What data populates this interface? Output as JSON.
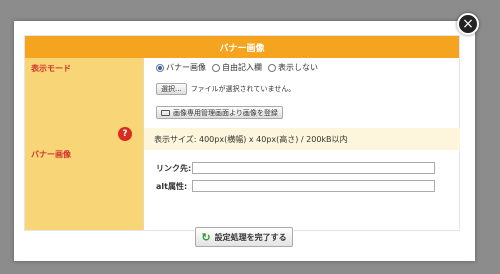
{
  "dialog": {
    "header_title": "バナー画像",
    "display_mode": {
      "label": "表示モード",
      "options": [
        "バナー画像",
        "自由記入欄",
        "表示しない"
      ],
      "selected": "バナー画像"
    },
    "banner": {
      "label": "バナー画像",
      "file_button": "選択...",
      "file_status": "ファイルが選択されていません。",
      "manager_button": "画像専用管理画面より画像を登録",
      "size_info": "表示サイズ: 400px(横幅) x 40px(高さ) / 200kB以内",
      "link_label": "リンク先:",
      "link_value": "",
      "alt_label": "alt属性:",
      "alt_value": "",
      "help_icon": "?"
    },
    "submit_button": "設定処理を完了する",
    "close_icon": "×"
  },
  "colors": {
    "header": "#f5a41f",
    "label_bg": "#f8d576",
    "label_text": "#d0342c",
    "overlay": "#8c8c8c"
  }
}
